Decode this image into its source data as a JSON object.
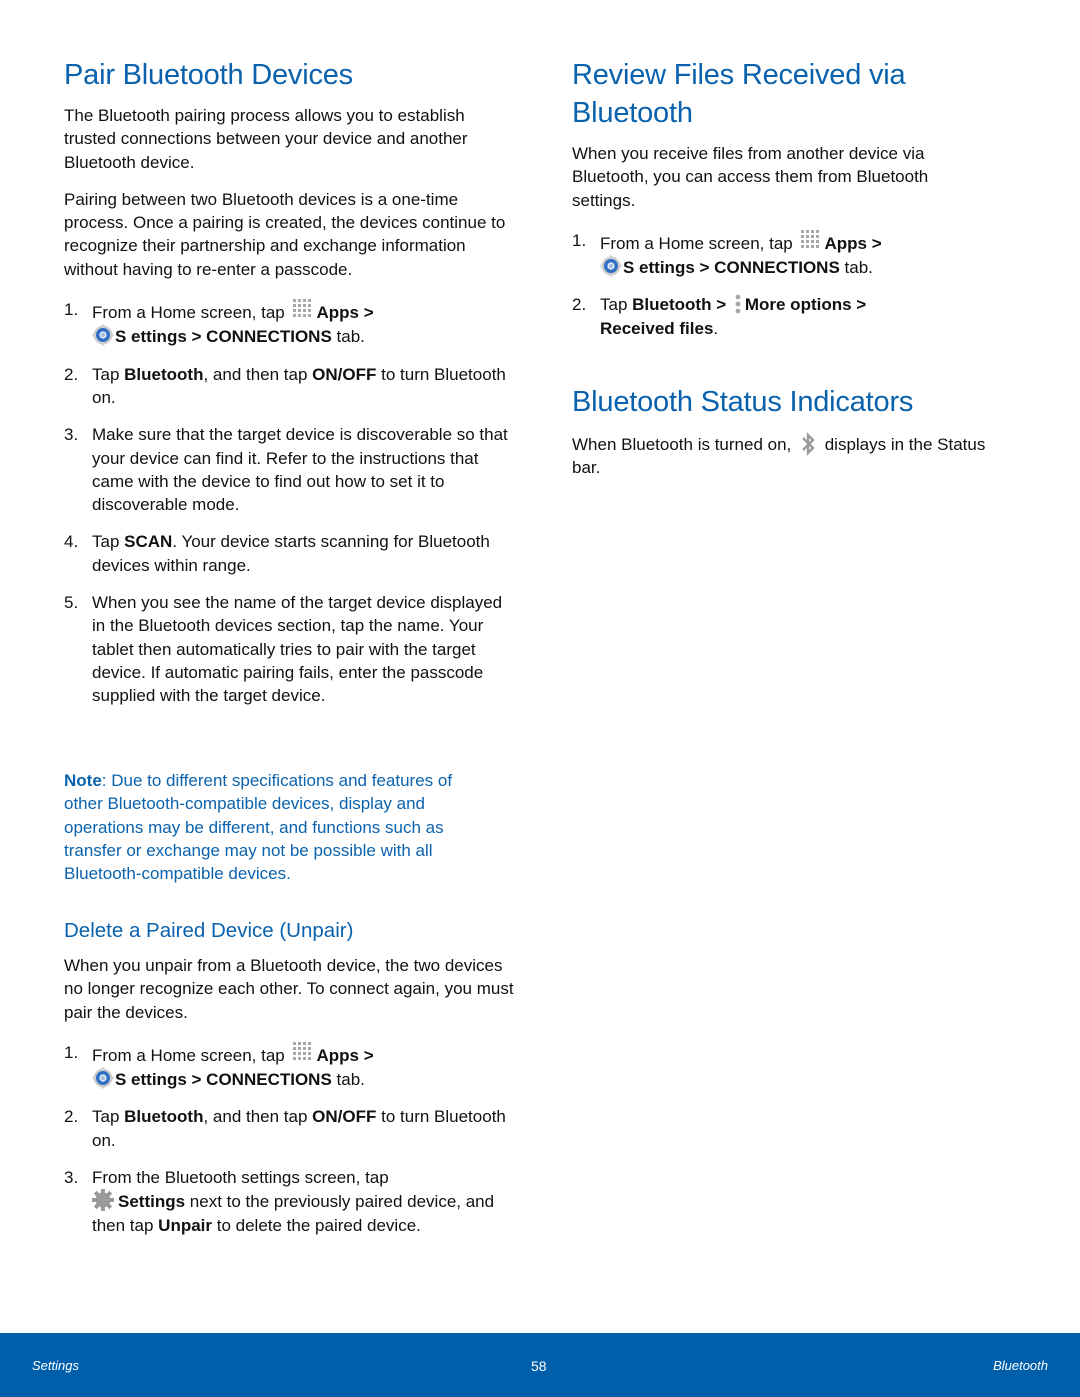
{
  "left": {
    "title": "Pair Bluetooth Devices",
    "intro1": "The Bluetooth pairing process allows you to establish trusted connections between your device and another Bluetooth device.",
    "intro2": "Pairing between two Bluetooth devices is a one-time process. Once a pairing is created, the devices continue to recognize their partnership and exchange information without having to re-enter a passcode.",
    "steps": [
      {
        "num": "1.",
        "a": "From a Home screen, tap ",
        "apps": "Apps",
        "gt1": " >",
        "settings": "S ettings",
        "gt2": " > ",
        "connections": "CONNECTIONS",
        "tail": " tab."
      },
      {
        "num": "2.",
        "a": "Tap ",
        "b1": "Bluetooth",
        "m": ", and then tap ",
        "b2": "ON/OFF",
        "tail": " to turn Bluetooth on."
      },
      {
        "num": "3.",
        "text": "Make sure that the target device is discoverable so that your device can find it. Refer to the instructions that came with the device to find out how to set it to discoverable mode."
      },
      {
        "num": "4.",
        "a": "Tap ",
        "b1": "SCAN",
        "tail": ". Your device starts scanning for Bluetooth devices within range."
      },
      {
        "num": "5.",
        "text": "When you see the name of the target device displayed in the Bluetooth devices section, tap the name. Your tablet then automatically tries to pair with the target device. If automatic pairing fails, enter the passcode supplied with the target device."
      }
    ],
    "note_label": "Note",
    "note_text": ": Due to different specifications and features of other Bluetooth-compatible devices, display and operations may be different, and functions such as transfer or exchange may not be possible with all Bluetooth-compatible devices.",
    "subsection": {
      "title": "Delete a Paired Device (Unpair)",
      "intro": "When you unpair from a Bluetooth device, the two devices no longer recognize each other. To connect again, you must pair the devices.",
      "steps": [
        {
          "num": "1.",
          "a": "From a Home screen, tap ",
          "apps": "Apps",
          "gt1": " >",
          "settings": "S ettings",
          "gt2": " > ",
          "connections": "CONNECTIONS",
          "tail": " tab."
        },
        {
          "num": "2.",
          "a": "Tap ",
          "b1": "Bluetooth",
          "m": ", and then tap ",
          "b2": "ON/OFF",
          "tail": " to turn Bluetooth on."
        },
        {
          "num": "3.",
          "a": "From the Bluetooth settings screen, tap ",
          "b1": "Settings",
          "m": " next to the previously paired device, and then tap ",
          "b2": "Unpair",
          "tail": " to delete the paired device."
        }
      ]
    }
  },
  "right": {
    "review": {
      "title": "Review Files Received via Bluetooth",
      "intro": "When you receive files from another device via Bluetooth, you can access them from Bluetooth settings.",
      "steps": [
        {
          "num": "1.",
          "a": "From a Home screen, tap ",
          "apps": "Apps",
          "gt1": " >",
          "settings": "S ettings",
          "gt2": " > ",
          "connections": "CONNECTIONS",
          "tail": " tab."
        },
        {
          "num": "2.",
          "a": "Tap ",
          "b1": "Bluetooth",
          "m": " > ",
          "b2": "More options",
          "m2": " > ",
          "b3": "Received files",
          "tail": "."
        }
      ]
    },
    "status": {
      "title": "Bluetooth Status Indicators",
      "a": "When Bluetooth is turned on, ",
      "tail": " displays in the Status bar."
    }
  },
  "footer": {
    "left": "Settings",
    "page": "58",
    "right": "Bluetooth"
  },
  "icons": {
    "apps": "apps-grid-icon",
    "settings": "settings-gear-icon",
    "gear": "gear-icon",
    "more": "more-options-icon",
    "bluetooth": "bluetooth-icon"
  },
  "colors": {
    "heading": "#0a62ad",
    "footer_bg": "#005fab",
    "body_text": "#111111"
  }
}
